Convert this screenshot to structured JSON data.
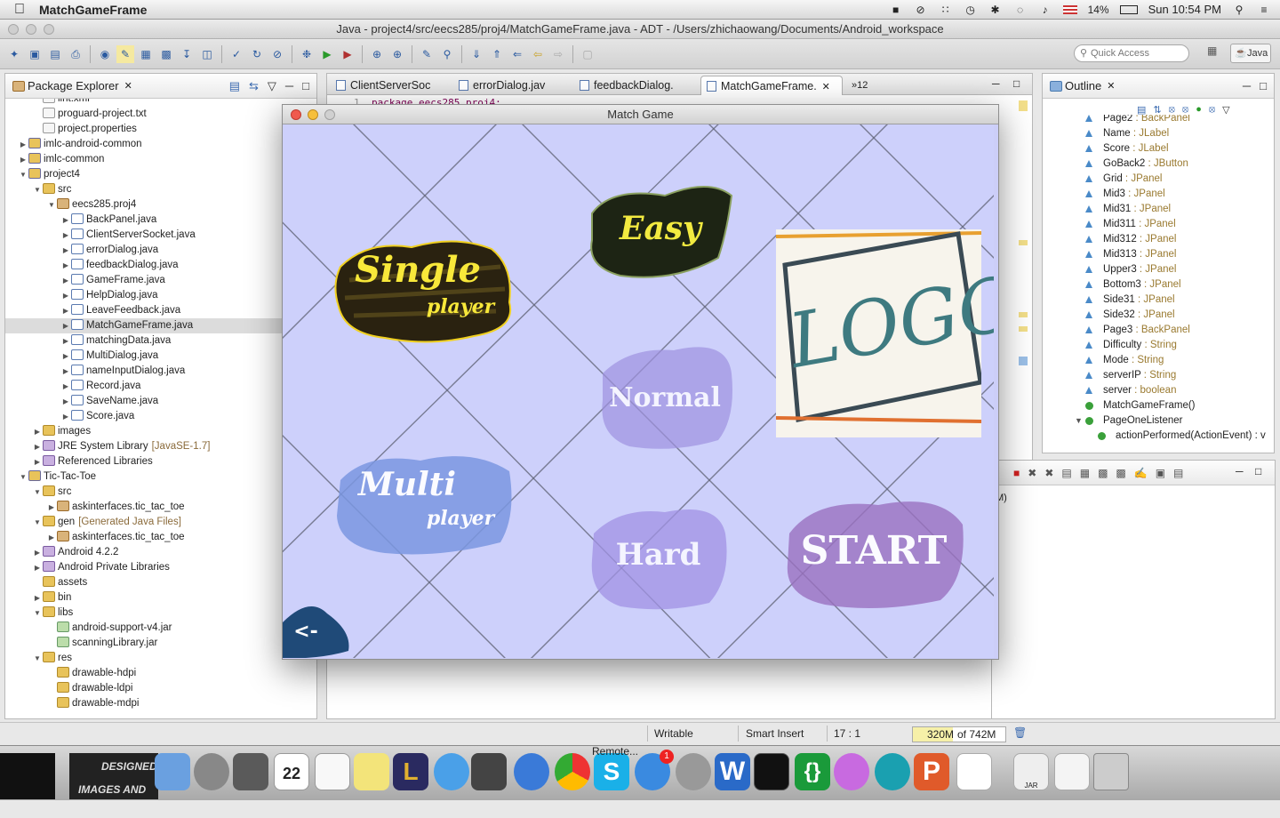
{
  "menubar": {
    "app_name": "MatchGameFrame",
    "battery": "14%",
    "clock": "Sun 10:54 PM"
  },
  "eclipse": {
    "window_title": "Java - project4/src/eecs285/proj4/MatchGameFrame.java - ADT - /Users/zhichaowang/Documents/Android_workspace",
    "quick_access_placeholder": "Quick Access",
    "perspective": "Java"
  },
  "package_explorer": {
    "tab_label": "Package Explorer",
    "rows": [
      {
        "label": "lint.xml",
        "deco": ""
      },
      {
        "label": "proguard-project.txt",
        "deco": ""
      },
      {
        "label": "project.properties",
        "deco": ""
      },
      {
        "label": "imlc-android-common",
        "deco": ""
      },
      {
        "label": "imlc-common",
        "deco": ""
      },
      {
        "label": "project4",
        "deco": ""
      },
      {
        "label": "src",
        "deco": ""
      },
      {
        "label": "eecs285.proj4",
        "deco": ""
      },
      {
        "label": "BackPanel.java",
        "deco": ""
      },
      {
        "label": "ClientServerSocket.java",
        "deco": ""
      },
      {
        "label": "errorDialog.java",
        "deco": ""
      },
      {
        "label": "feedbackDialog.java",
        "deco": ""
      },
      {
        "label": "GameFrame.java",
        "deco": ""
      },
      {
        "label": "HelpDialog.java",
        "deco": ""
      },
      {
        "label": "LeaveFeedback.java",
        "deco": ""
      },
      {
        "label": "MatchGameFrame.java",
        "deco": ""
      },
      {
        "label": "matchingData.java",
        "deco": ""
      },
      {
        "label": "MultiDialog.java",
        "deco": ""
      },
      {
        "label": "nameInputDialog.java",
        "deco": ""
      },
      {
        "label": "Record.java",
        "deco": ""
      },
      {
        "label": "SaveName.java",
        "deco": ""
      },
      {
        "label": "Score.java",
        "deco": ""
      },
      {
        "label": "images",
        "deco": ""
      },
      {
        "label": "JRE System Library",
        "deco": "[JavaSE-1.7]"
      },
      {
        "label": "Referenced Libraries",
        "deco": ""
      },
      {
        "label": "Tic-Tac-Toe",
        "deco": ""
      },
      {
        "label": "src",
        "deco": ""
      },
      {
        "label": "askinterfaces.tic_tac_toe",
        "deco": ""
      },
      {
        "label": "gen",
        "deco": "[Generated Java Files]"
      },
      {
        "label": "askinterfaces.tic_tac_toe",
        "deco": ""
      },
      {
        "label": "Android 4.2.2",
        "deco": ""
      },
      {
        "label": "Android Private Libraries",
        "deco": ""
      },
      {
        "label": "assets",
        "deco": ""
      },
      {
        "label": "bin",
        "deco": ""
      },
      {
        "label": "libs",
        "deco": ""
      },
      {
        "label": "android-support-v4.jar",
        "deco": ""
      },
      {
        "label": "scanningLibrary.jar",
        "deco": ""
      },
      {
        "label": "res",
        "deco": ""
      },
      {
        "label": "drawable-hdpi",
        "deco": ""
      },
      {
        "label": "drawable-ldpi",
        "deco": ""
      },
      {
        "label": "drawable-mdpi",
        "deco": ""
      }
    ]
  },
  "editor": {
    "tabs": [
      {
        "label": "ClientServerSoc"
      },
      {
        "label": "errorDialog.jav"
      },
      {
        "label": "feedbackDialog."
      },
      {
        "label": "MatchGameFrame."
      }
    ],
    "overflow_count": "»12",
    "visible_code": "package eecs285.proj4;",
    "line_number": "1"
  },
  "outline": {
    "tab_label": "Outline",
    "rows": [
      {
        "name": "Page2",
        "type": " : BackPanel"
      },
      {
        "name": "Name",
        "type": " : JLabel"
      },
      {
        "name": "Score",
        "type": " : JLabel"
      },
      {
        "name": "GoBack2",
        "type": " : JButton"
      },
      {
        "name": "Grid",
        "type": " : JPanel"
      },
      {
        "name": "Mid3",
        "type": " : JPanel"
      },
      {
        "name": "Mid31",
        "type": " : JPanel"
      },
      {
        "name": "Mid311",
        "type": " : JPanel"
      },
      {
        "name": "Mid312",
        "type": " : JPanel"
      },
      {
        "name": "Mid313",
        "type": " : JPanel"
      },
      {
        "name": "Upper3",
        "type": " : JPanel"
      },
      {
        "name": "Bottom3",
        "type": " : JPanel"
      },
      {
        "name": "Side31",
        "type": " : JPanel"
      },
      {
        "name": "Side32",
        "type": " : JPanel"
      },
      {
        "name": "Page3",
        "type": " : BackPanel"
      },
      {
        "name": "Difficulty",
        "type": " : String"
      },
      {
        "name": "Mode",
        "type": " : String"
      },
      {
        "name": "serverIP",
        "type": " : String"
      },
      {
        "name": "server",
        "type": " : boolean"
      },
      {
        "name": "MatchGameFrame()",
        "type": ""
      },
      {
        "name": "PageOneListener",
        "type": ""
      },
      {
        "name": "actionPerformed(ActionEvent) : v",
        "type": ""
      }
    ]
  },
  "console": {
    "fragment": "M)"
  },
  "statusbar": {
    "writable": "Writable",
    "insert_mode": "Smart Insert",
    "cursor_pos": "17 : 1",
    "heap_used": "320M",
    "heap_total": "of 742M",
    "heap_fraction": 0.43
  },
  "match_game": {
    "window_title": "Match Game",
    "single_top": "Single",
    "single_bottom": "player",
    "multi_top": "Multi",
    "multi_bottom": "player",
    "easy": "Easy",
    "normal": "Normal",
    "hard": "Hard",
    "start": "START",
    "back": "<-",
    "logo_text": "LOGO"
  },
  "dock": {
    "left_text_1": "DESIGNED",
    "left_text_2": "IMAGES AND",
    "calendar_day": "22",
    "remote_label": "Remote...",
    "badge": "1",
    "jar_label": "JAR"
  }
}
